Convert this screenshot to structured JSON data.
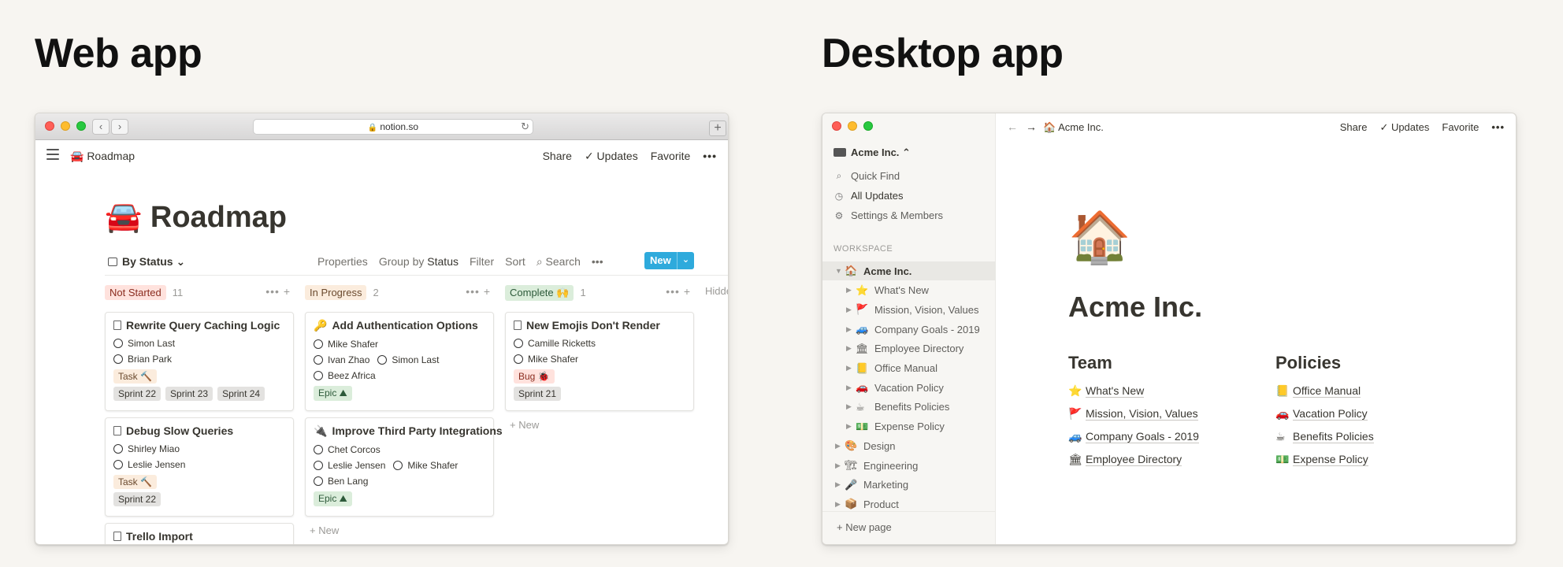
{
  "headings": {
    "web": "Web app",
    "desktop": "Desktop app"
  },
  "web": {
    "url": "notion.so",
    "breadcrumb": "🚘 Roadmap",
    "topbar": {
      "share": "Share",
      "updates": "✓ Updates",
      "favorite": "Favorite",
      "more": "•••"
    },
    "page_title": "🚘 Roadmap",
    "view": {
      "name": "By Status ⌄",
      "properties": "Properties",
      "group_by": "Group by",
      "group_value": "Status",
      "filter": "Filter",
      "sort": "Sort",
      "search": "⌕ Search",
      "more": "•••",
      "new_label": "New",
      "new_caret": "⌄"
    },
    "hidden_label": "Hidde",
    "columns": [
      {
        "label": "Not Started",
        "count": "11",
        "color": "#ffe2dd",
        "text_color": "#8a2c1f",
        "cards": [
          {
            "title": "Rewrite Query Caching Logic",
            "people": [
              [
                "Simon Last"
              ],
              [
                "Brian Park"
              ]
            ],
            "type_tag": "Task 🔨",
            "sprints": [
              "Sprint 22",
              "Sprint 23",
              "Sprint 24"
            ]
          },
          {
            "title": "Debug Slow Queries",
            "people": [
              [
                "Shirley Miao"
              ],
              [
                "Leslie Jensen"
              ]
            ],
            "type_tag": "Task 🔨",
            "sprints": [
              "Sprint 22"
            ]
          },
          {
            "title": "Trello Import"
          }
        ]
      },
      {
        "label": "In Progress",
        "count": "2",
        "color": "#fbecdd",
        "text_color": "#6b4a2e",
        "cards": [
          {
            "emoji": "🔑",
            "title": "Add Authentication Options",
            "people": [
              [
                "Mike Shafer"
              ],
              [
                "Ivan Zhao",
                "Simon Last"
              ],
              [
                "Beez Africa"
              ]
            ],
            "type_tag": "Epic ⛰",
            "sprints": []
          },
          {
            "emoji": "🔌",
            "title": "Improve Third Party Integrations",
            "people": [
              [
                "Chet Corcos"
              ],
              [
                "Leslie Jensen",
                "Mike Shafer"
              ],
              [
                "Ben Lang"
              ]
            ],
            "type_tag": "Epic ⛰",
            "sprints": []
          }
        ],
        "add_new": "+ New"
      },
      {
        "label": "Complete 🙌",
        "count": "1",
        "color": "#dbeddb",
        "text_color": "#2d5a3a",
        "cards": [
          {
            "title": "New Emojis Don't Render",
            "people": [
              [
                "Camille Ricketts"
              ],
              [
                "Mike Shafer"
              ]
            ],
            "type_tag": "Bug 🐞",
            "sprints": [
              "Sprint 21"
            ]
          }
        ],
        "add_new": "+ New"
      }
    ],
    "column_controls": "••• +"
  },
  "desktop": {
    "workspace": "Acme Inc. ⌃",
    "quick_find": "Quick Find",
    "all_updates": "All Updates",
    "settings": "Settings & Members",
    "section_label": "WORKSPACE",
    "tree": [
      {
        "emoji": "🏠",
        "label": "Acme Inc.",
        "level": 0,
        "open": true
      },
      {
        "emoji": "⭐",
        "label": "What's New",
        "level": 1
      },
      {
        "emoji": "🚩",
        "label": "Mission, Vision, Values",
        "level": 1
      },
      {
        "emoji": "🚙",
        "label": "Company Goals - 2019",
        "level": 1
      },
      {
        "emoji": "🏛",
        "label": "Employee Directory",
        "level": 1
      },
      {
        "emoji": "📒",
        "label": "Office Manual",
        "level": 1
      },
      {
        "emoji": "🚗",
        "label": "Vacation Policy",
        "level": 1
      },
      {
        "emoji": "☕",
        "label": "Benefits Policies",
        "level": 1
      },
      {
        "emoji": "💵",
        "label": "Expense Policy",
        "level": 1
      },
      {
        "emoji": "🎨",
        "label": "Design",
        "level": 0
      },
      {
        "emoji": "🏗",
        "label": "Engineering",
        "level": 0
      },
      {
        "emoji": "🎤",
        "label": "Marketing",
        "level": 0
      },
      {
        "emoji": "📦",
        "label": "Product",
        "level": 0
      }
    ],
    "new_page": "+ New page",
    "breadcrumb": "🏠 Acme Inc.",
    "topbar": {
      "share": "Share",
      "updates": "✓ Updates",
      "favorite": "Favorite",
      "more": "•••"
    },
    "page_icon": "🏠",
    "page_title": "Acme Inc.",
    "team": {
      "heading": "Team",
      "links": [
        {
          "emoji": "⭐",
          "label": "What's New"
        },
        {
          "emoji": "🚩",
          "label": "Mission, Vision, Values"
        },
        {
          "emoji": "🚙",
          "label": "Company Goals - 2019"
        },
        {
          "emoji": "🏛",
          "label": "Employee Directory"
        }
      ]
    },
    "policies": {
      "heading": "Policies",
      "links": [
        {
          "emoji": "📒",
          "label": "Office Manual"
        },
        {
          "emoji": "🚗",
          "label": "Vacation Policy"
        },
        {
          "emoji": "☕",
          "label": "Benefits Policies"
        },
        {
          "emoji": "💵",
          "label": "Expense Policy"
        }
      ]
    }
  }
}
